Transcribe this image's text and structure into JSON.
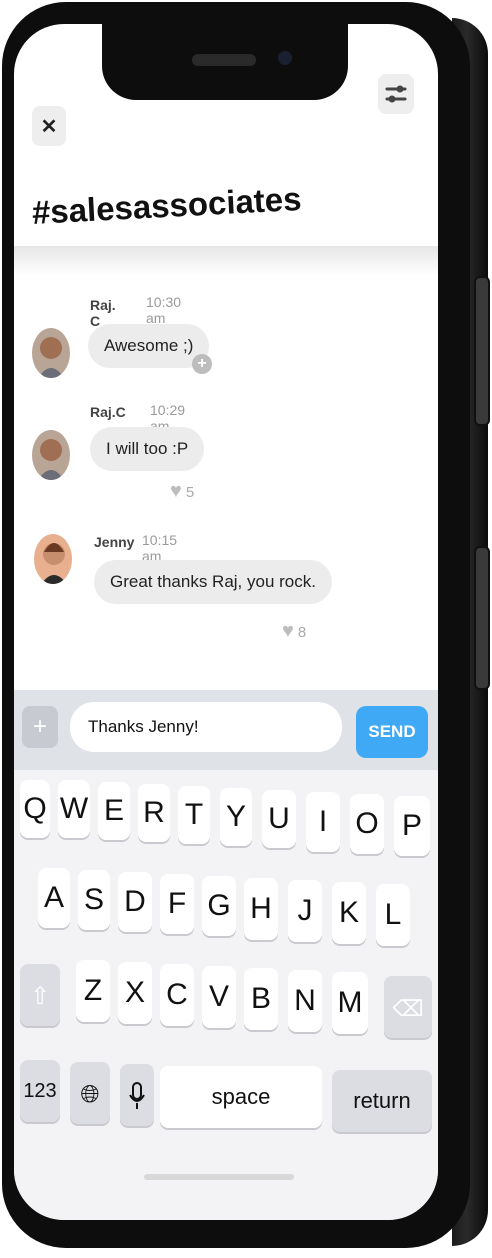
{
  "header": {
    "channel": "#salesassociates"
  },
  "icons": {
    "close": "close-icon",
    "filter": "filter-sliders-icon"
  },
  "messages": [
    {
      "name": "Raj. C",
      "time": "10:30 am",
      "text": "Awesome ;)",
      "likes": ""
    },
    {
      "name": "Raj.C",
      "time": "10:29 am",
      "text": "I will too :P",
      "likes": "5"
    },
    {
      "name": "Jenny",
      "time": "10:15 am",
      "text": "Great thanks Raj, you rock.",
      "likes": "8"
    }
  ],
  "composer": {
    "value": "Thanks Jenny!",
    "send_label": "SEND"
  },
  "keyboard": {
    "row1": [
      "Q",
      "W",
      "E",
      "R",
      "T",
      "Y",
      "U",
      "I",
      "O",
      "P"
    ],
    "row2": [
      "A",
      "S",
      "D",
      "F",
      "G",
      "H",
      "J",
      "K",
      "L"
    ],
    "row3": [
      "Z",
      "X",
      "C",
      "V",
      "B",
      "N",
      "M"
    ],
    "num_label": "123",
    "space_label": "space",
    "return_label": "return"
  }
}
